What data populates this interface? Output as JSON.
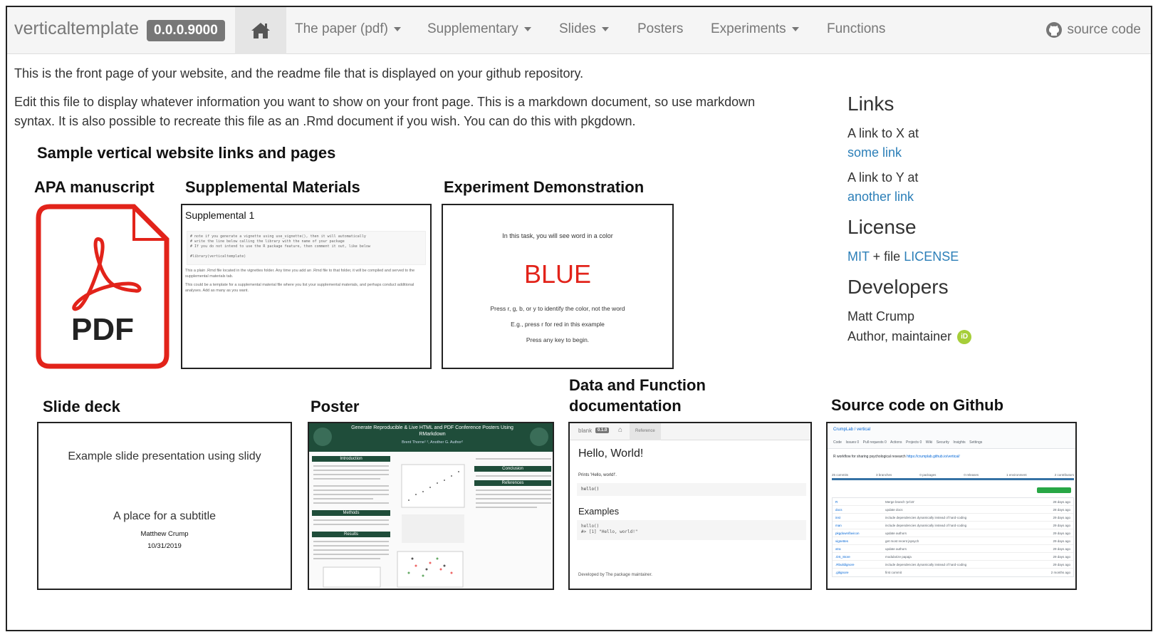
{
  "navbar": {
    "brand": "verticaltemplate",
    "version": "0.0.0.9000",
    "items": [
      {
        "label": "The paper (pdf)"
      },
      {
        "label": "Supplementary"
      },
      {
        "label": "Slides"
      },
      {
        "label": "Posters"
      },
      {
        "label": "Experiments"
      },
      {
        "label": "Functions"
      }
    ],
    "source": "source code"
  },
  "main": {
    "intro": "This is the front page of your website, and the readme file that is displayed on your github repository.",
    "edit_line1": "Edit this file to display whatever information you want to show on your front page. This is a markdown document, so use markdown",
    "edit_line2": "syntax. It is also possible to recreate this file as an .Rmd document if you wish. You can do this with pkgdown.",
    "section_title": "Sample vertical website links and pages",
    "cards": {
      "apa": "APA manuscript",
      "supp": "Supplemental Materials",
      "exp": "Experiment Demonstration",
      "slide": "Slide deck",
      "poster": "Poster",
      "docs_line1": "Data and Function",
      "docs_line2": "documentation",
      "github": "Source code on Github"
    }
  },
  "sidebar": {
    "links_title": "Links",
    "link1_pre": "A link to X at",
    "link1": "some link",
    "link2_pre": "A link to Y at",
    "link2": "another link",
    "license_title": "License",
    "license_mit": "MIT",
    "license_mid": " + file ",
    "license_file": "LICENSE",
    "dev_title": "Developers",
    "dev_name": "Matt Crump",
    "dev_role": "Author, maintainer",
    "orcid": "iD"
  },
  "thumbs": {
    "pdf_label": "PDF",
    "supp_title": "Supplemental 1",
    "supp_code": [
      "# note if you generate a vignette using use_vignette(), then it will automatically",
      "# write the line below calling the library with the name of your package",
      "# If you do not intend to use the R package feature, then comment it out, like below",
      "",
      "#library(verticaltemplate)"
    ],
    "supp_p1": "This a plain .Rmd file located in the vignettes folder. Any time you add an .Rmd file to that folder, it will be compiled and served to the supplemental materials tab.",
    "supp_p2": "This could be a template for a supplemental material file where you list your supplemental materials, and perhaps conduct additional analyses. Add as many as you want.",
    "exp_line1": "In this task, you will see word in a color",
    "exp_word": "BLUE",
    "exp_line2": "Press r, g, b, or y to identify the color, not the word",
    "exp_line3": "E.g., press r for red in this example",
    "exp_line4": "Press any key to begin.",
    "slide_title": "Example slide presentation using slidy",
    "slide_subtitle": "A place for a subtitle",
    "slide_author": "Matthew Crump",
    "slide_date": "10/31/2019",
    "poster_title": "Generate Reproducible & Live HTML and PDF Conference Posters Using RMarkdown",
    "poster_authors": "Brent Thorne¹ ², Another G. Author²",
    "poster_sections": [
      "Introduction",
      "Methods",
      "Results",
      "Conclusion",
      "References"
    ],
    "doc_brand": "blank",
    "doc_version": "0.1.0",
    "doc_ref": "Reference",
    "doc_title": "Hello, World!",
    "doc_prints": "Prints 'Hello, world!'.",
    "doc_code": "hello()",
    "doc_examples": "Examples",
    "doc_example_code1": "hello()",
    "doc_example_code2": "#> [1] \"Hello, world!\"",
    "doc_footer": "Developed by The package maintainer.",
    "gh_repo": "CrumpLab / vertical",
    "gh_desc": "R workflow for sharing psychological research",
    "gh_url": "https://crumplab.github.io/vertical/",
    "gh_stats": [
      "25 commits",
      "3 branches",
      "0 packages",
      "0 releases",
      "1 environment",
      "2 contributors"
    ],
    "gh_files": [
      {
        "name": "R",
        "msg": "Merge branch 'pr/15'",
        "age": "28 days ago"
      },
      {
        "name": "docs",
        "msg": "update docs",
        "age": "28 days ago"
      },
      {
        "name": "inst",
        "msg": "include dependencies dynamically instead of hard-coding",
        "age": "29 days ago"
      },
      {
        "name": "man",
        "msg": "include dependencies dynamically instead of hard-coding",
        "age": "29 days ago"
      },
      {
        "name": "pkgdown/favicon",
        "msg": "update authors",
        "age": "29 days ago"
      },
      {
        "name": "vignettes",
        "msg": "get most recent jspsych",
        "age": "29 days ago"
      },
      {
        "name": "xtra",
        "msg": "update authors",
        "age": "29 days ago"
      },
      {
        "name": ".DS_Store",
        "msg": "modularize papaja",
        "age": "29 days ago"
      },
      {
        "name": ".Rbuildignore",
        "msg": "include dependencies dynamically instead of hard-coding",
        "age": "29 days ago"
      },
      {
        "name": ".gitignore",
        "msg": "first commit",
        "age": "2 months ago"
      }
    ]
  },
  "colors": {
    "link": "#2c7fb8",
    "pdf_red": "#e2231a",
    "poster_green": "#1f4d3a",
    "orcid_green": "#a6ce39",
    "blue_word": "#e2231a"
  }
}
